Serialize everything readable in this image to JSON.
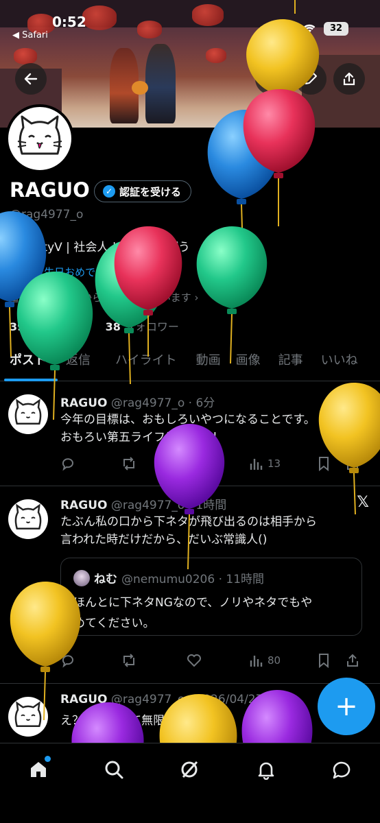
{
  "status_bar": {
    "time": "0:52",
    "back_app": "◀ Safari",
    "battery": "32"
  },
  "profile": {
    "name": "RAGUO",
    "verify_label": "認証を受ける",
    "handle": "@rag4977_o",
    "bio": "IdentityV | 社会人 | 楽しく遊ぼう",
    "birthday": "お誕生日おめでとうございます。",
    "joined": "2023年11月からXを利用しています",
    "following_count": "39",
    "following_label": "フォロー中",
    "followers_count": "38",
    "followers_label": "フォロワー"
  },
  "tabs": [
    {
      "label": "ポスト"
    },
    {
      "label": "返信"
    },
    {
      "label": "ハイライト"
    },
    {
      "label": "動画"
    },
    {
      "label": "画像"
    },
    {
      "label": "記事"
    },
    {
      "label": "いいね"
    }
  ],
  "posts": [
    {
      "name": "RAGUO",
      "meta": "@rag4977_o · 6分",
      "text": [
        "今年の目標は、おもしろいやつになることです。",
        "おもろい第五ライフにするぞ！"
      ],
      "views": "13"
    },
    {
      "name": "RAGUO",
      "meta": "@rag4977_o · 1時間",
      "text": [
        "たぶん私の口から下ネタが飛び出るのは相手から",
        "言われた時だけだから、だいぶ常識人()"
      ],
      "views": "80",
      "quote": {
        "name": "ねむ",
        "meta": "@nemumu0206 · 11時間",
        "text": [
          "ほんとに下ネタNGなので、ノリやネタでもや",
          "めてください。"
        ]
      }
    },
    {
      "name": "RAGUO",
      "meta": "@rag4977_o · 2026/04/27",
      "text": [
        "え？歯医者って無限.5？？？"
      ]
    }
  ],
  "icons": {
    "back": "arrow-left-icon",
    "search": "search-icon",
    "edit": "pencil-icon",
    "share": "share-icon",
    "reply": "reply-icon",
    "repost": "repost-icon",
    "like": "heart-icon",
    "views": "bar-chart-icon",
    "bookmark": "bookmark-icon",
    "grok": "grok-icon",
    "compose": "plus-icon",
    "home": "home-icon",
    "notifications": "bell-icon",
    "messages": "message-icon"
  },
  "colors": {
    "accent": "#1d9bf0",
    "background": "#000000",
    "muted": "#71767b"
  }
}
